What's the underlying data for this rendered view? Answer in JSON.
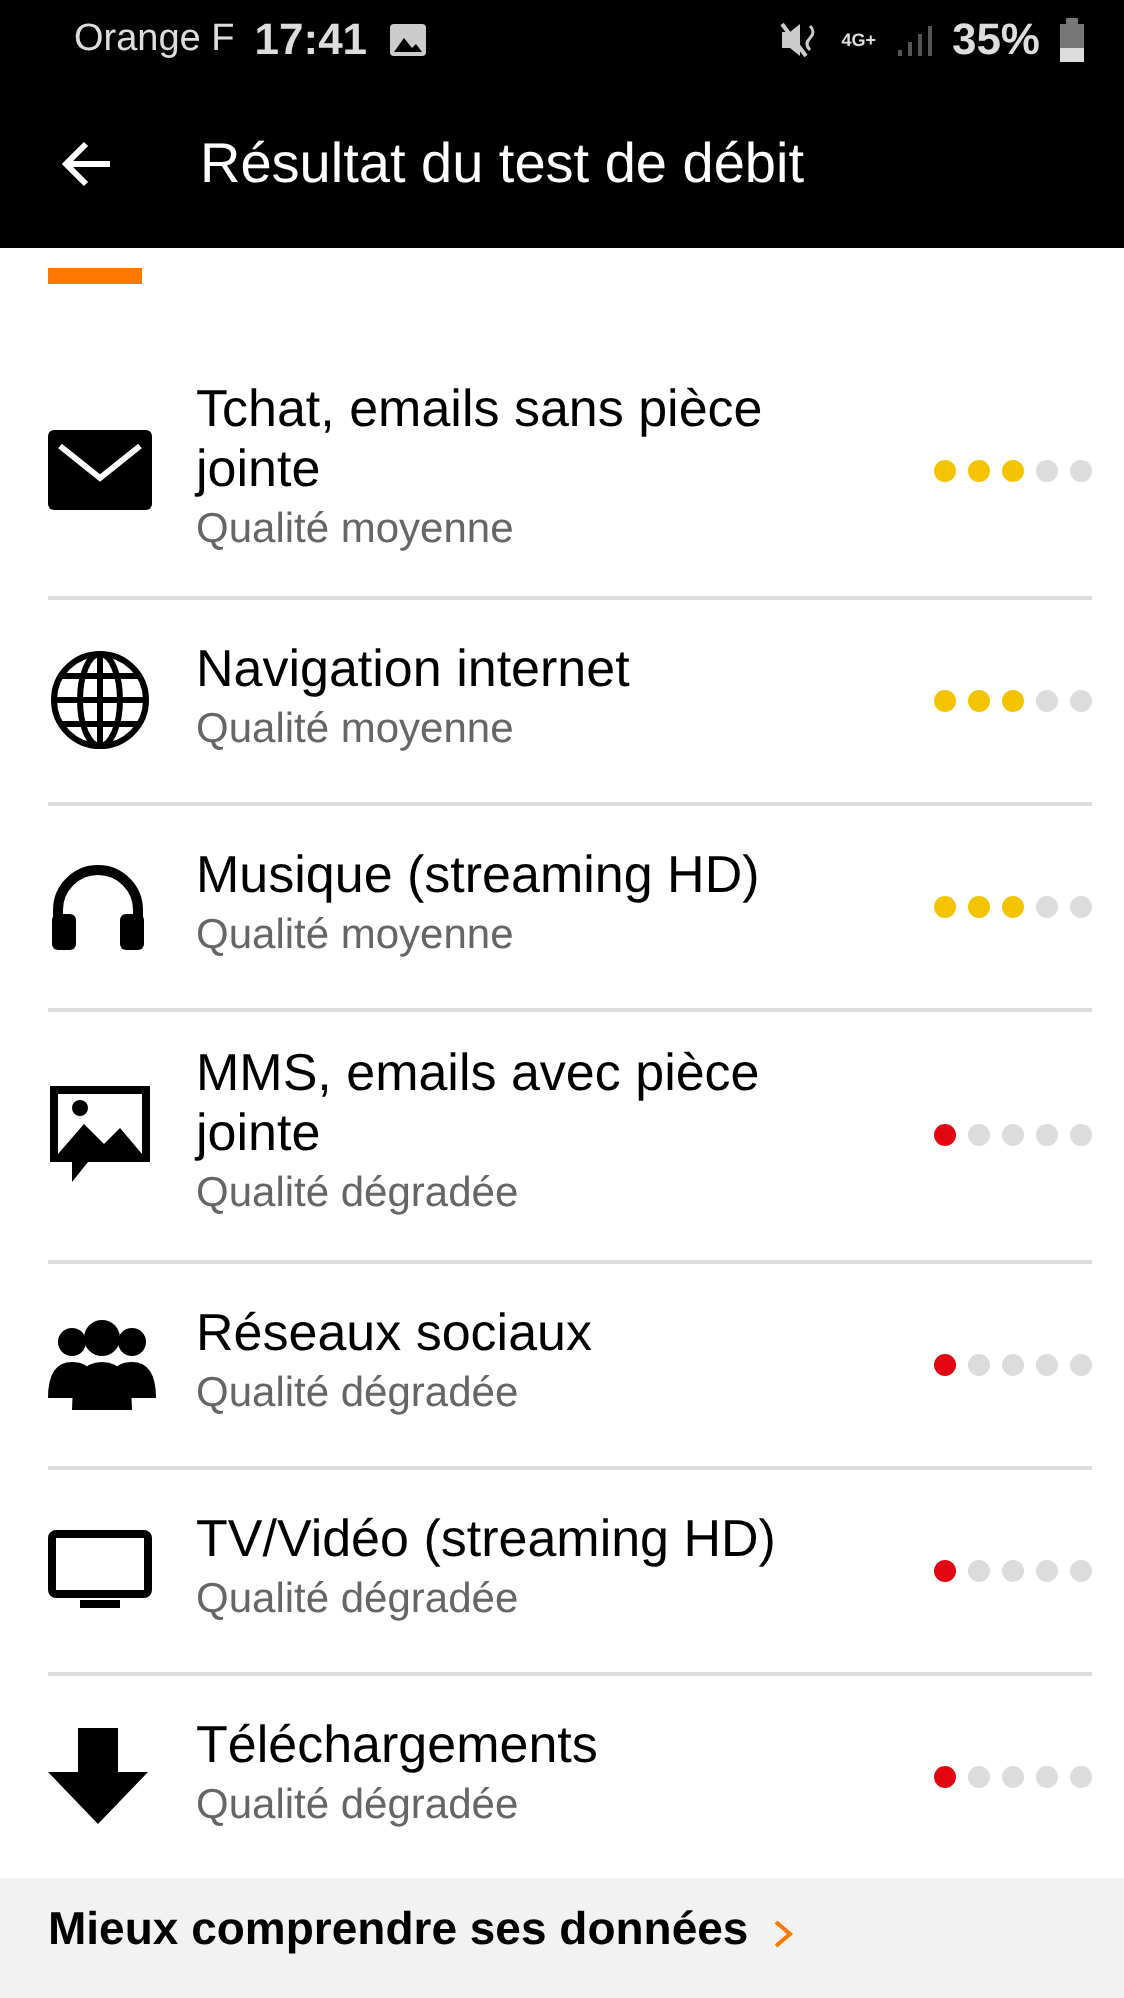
{
  "status_bar": {
    "carrier": "Orange F",
    "time": "17:41",
    "network": "4G+",
    "battery": "35%"
  },
  "header": {
    "title": "Résultat du test de débit"
  },
  "services": [
    {
      "kind": "mail",
      "title": "Tchat, emails sans pièce jointe",
      "quality": "Qualité moyenne",
      "stars": 3,
      "color": "#f5c400"
    },
    {
      "kind": "globe",
      "title": "Navigation internet",
      "quality": "Qualité moyenne",
      "stars": 3,
      "color": "#f5c400"
    },
    {
      "kind": "headphones",
      "title": "Musique (streaming HD)",
      "quality": "Qualité moyenne",
      "stars": 3,
      "color": "#f5c400"
    },
    {
      "kind": "image",
      "title": "MMS, emails avec pièce jointe",
      "quality": "Qualité dégradée",
      "stars": 1,
      "color": "#e30613"
    },
    {
      "kind": "people",
      "title": "Réseaux sociaux",
      "quality": "Qualité dégradée",
      "stars": 1,
      "color": "#e30613"
    },
    {
      "kind": "tv",
      "title": "TV/Vidéo (streaming HD)",
      "quality": "Qualité dégradée",
      "stars": 1,
      "color": "#e30613"
    },
    {
      "kind": "download",
      "title": "Téléchargements",
      "quality": "Qualité dégradée",
      "stars": 1,
      "color": "#e30613"
    }
  ],
  "footer": {
    "title": "Mieux comprendre ses données"
  }
}
